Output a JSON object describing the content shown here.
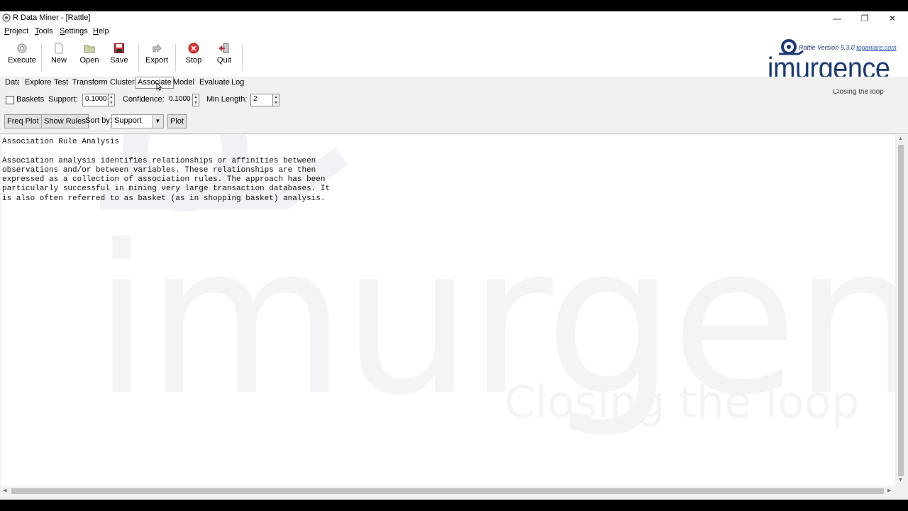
{
  "window": {
    "title": "R Data Miner - [Rattle]"
  },
  "menu": [
    {
      "label": "Project",
      "underline": "P",
      "rest": "roject"
    },
    {
      "label": "Tools",
      "underline": "T",
      "rest": "ools"
    },
    {
      "label": "Settings",
      "underline": "S",
      "rest": "ettings"
    },
    {
      "label": "Help",
      "underline": "H",
      "rest": "elp"
    }
  ],
  "toolbar": {
    "execute": "Execute",
    "new": "New",
    "open": "Open",
    "save": "Save",
    "export": "Export",
    "stop": "Stop",
    "quit": "Quit"
  },
  "branding": {
    "version_text": "Rattle Version 5.3.0",
    "link_text": "togaware.com",
    "logo_word": "imurgence",
    "tagline": "Closing the loop"
  },
  "tabs": [
    "Data",
    "Explore",
    "Test",
    "Transform",
    "Cluster",
    "Associate",
    "Model",
    "Evaluate",
    "Log"
  ],
  "active_tab": "Associate",
  "options": {
    "baskets_label": "Baskets",
    "baskets_checked": false,
    "support_label": "Support:",
    "support_value": "0.1000",
    "confidence_label": "Confidence:",
    "confidence_value": "0.1000",
    "minlength_label": "Min Length:",
    "minlength_value": "2"
  },
  "actions": {
    "freq_plot": "Freq Plot",
    "show_rules": "Show Rules",
    "sort_by_label": "Sort by:",
    "sort_by_value": "Support",
    "plot": "Plot"
  },
  "text_output": "Association Rule Analysis\n\nAssociation analysis identifies relationships or affinities between\nobservations and/or between variables. These relationships are then\nexpressed as a collection of association rules. The approach has been\nparticularly successful in mining very large transaction databases. It\nis also often referred to as basket (as in shopping basket) analysis.",
  "colors": {
    "brand": "#1c3a76",
    "stop_red": "#e03030",
    "window_bg": "#f0f0f0"
  },
  "icons": [
    "execute-icon",
    "new-icon",
    "open-icon",
    "save-icon",
    "export-icon",
    "stop-icon",
    "quit-icon"
  ]
}
